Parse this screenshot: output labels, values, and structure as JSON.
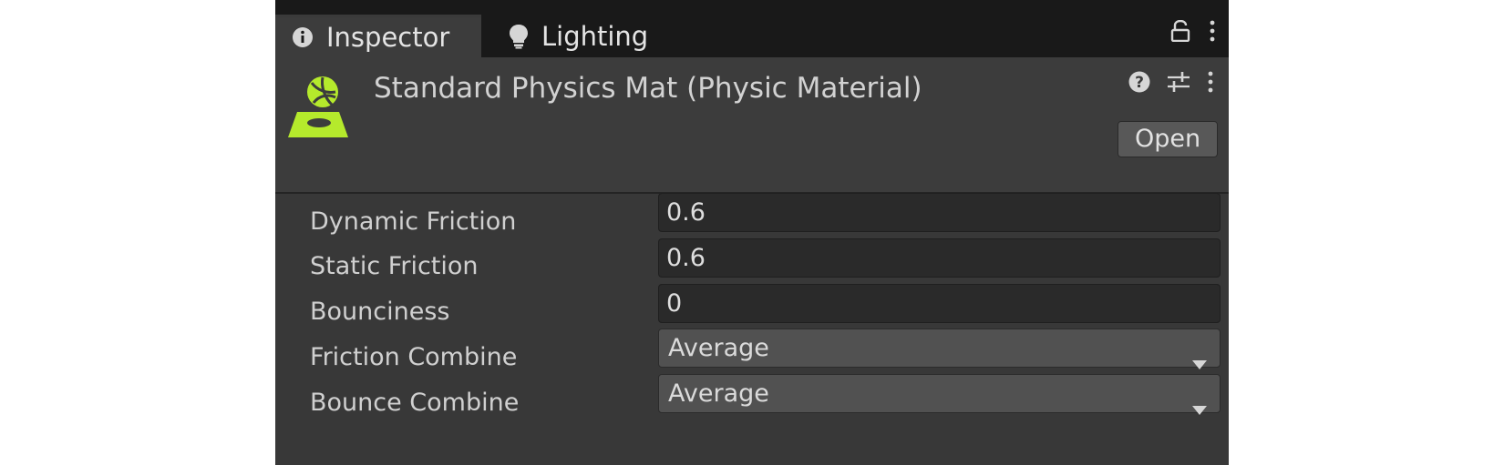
{
  "tabs": [
    {
      "label": "Inspector",
      "icon": "info-icon",
      "active": true
    },
    {
      "label": "Lighting",
      "icon": "lightbulb-icon",
      "active": false
    }
  ],
  "tab_tools": {
    "lock_icon": "lock-icon",
    "menu_icon": "kebab-menu-icon"
  },
  "asset": {
    "title": "Standard Physics Mat (Physic Material)",
    "icon": "physic-material-icon",
    "icon_color": "#b5ea2c"
  },
  "header_tools": {
    "help_icon": "help-icon",
    "preset_icon": "presets-icon",
    "menu_icon": "kebab-menu-icon"
  },
  "open_label": "Open",
  "properties": [
    {
      "label": "Dynamic Friction",
      "value": "0.6"
    },
    {
      "label": "Static Friction",
      "value": "0.6"
    },
    {
      "label": "Bounciness",
      "value": "0"
    },
    {
      "label": "Friction Combine",
      "value": "Average"
    },
    {
      "label": "Bounce Combine",
      "value": "Average"
    }
  ],
  "colors": {
    "panel_bg": "#383838",
    "header_bg": "#3c3c3c",
    "field_bg": "#2a2a2a",
    "dropdown_bg": "#515151"
  }
}
